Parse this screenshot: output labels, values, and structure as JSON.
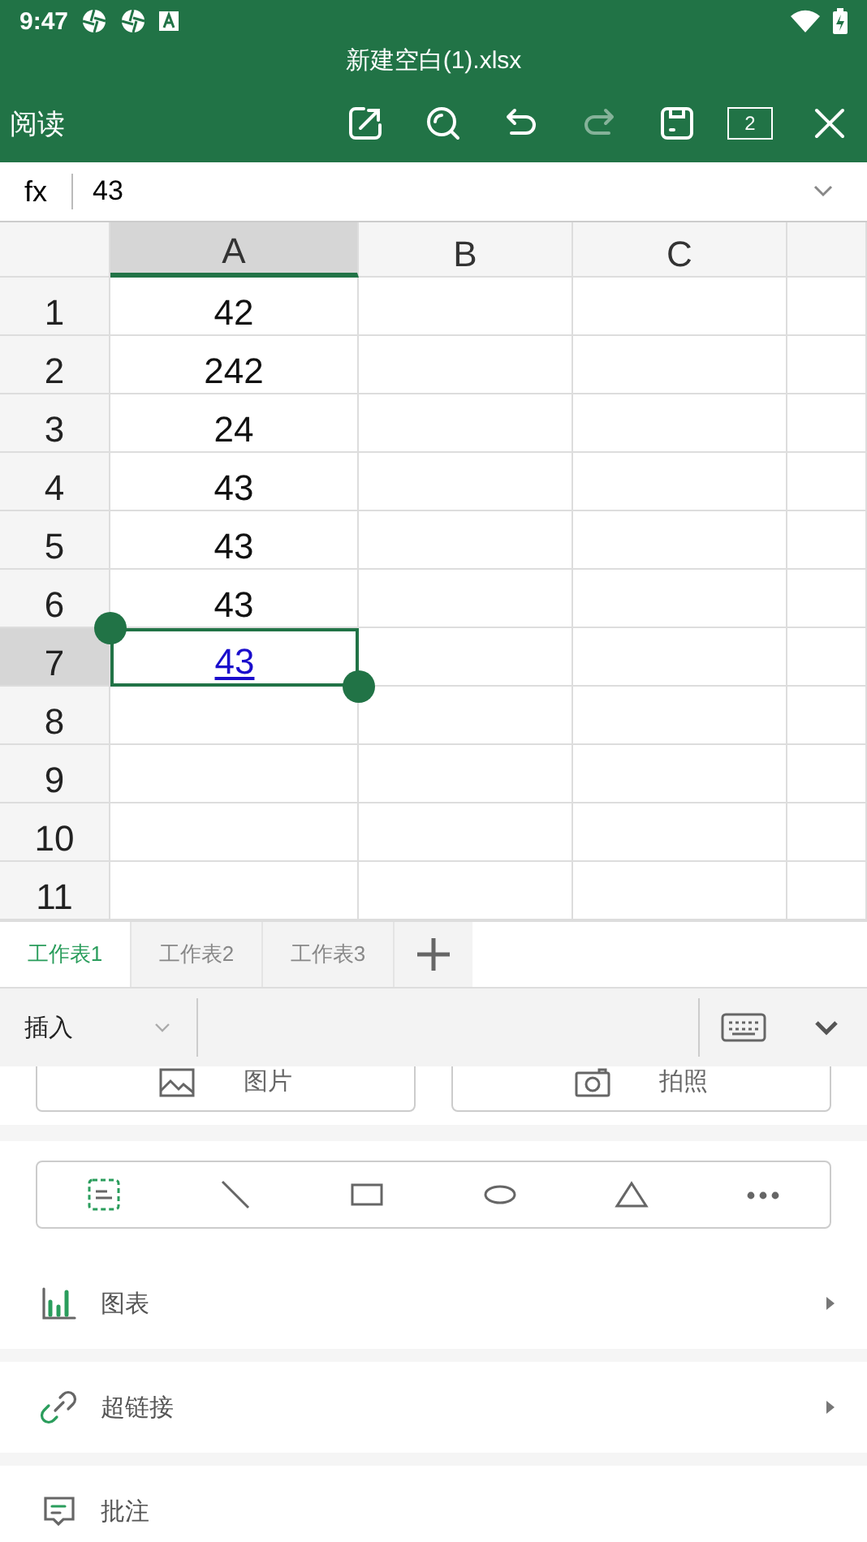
{
  "status_bar": {
    "time": "9:47"
  },
  "title": "新建空白(1).xlsx",
  "toolbar": {
    "mode": "阅读",
    "buttons": [
      {
        "kind": "share",
        "disabled": false
      },
      {
        "kind": "search",
        "disabled": false
      },
      {
        "kind": "undo",
        "disabled": false
      },
      {
        "kind": "redo",
        "disabled": true
      },
      {
        "kind": "save",
        "disabled": false
      },
      {
        "kind": "windows",
        "label": "2",
        "disabled": false
      },
      {
        "kind": "close",
        "disabled": false
      }
    ]
  },
  "formula_bar": {
    "label": "fx",
    "value": "43"
  },
  "sheet": {
    "columns": [
      {
        "label": "A",
        "selected": true
      },
      {
        "label": "B",
        "selected": false
      },
      {
        "label": "C",
        "selected": false
      }
    ],
    "rows": [
      {
        "label": "1",
        "selected": false,
        "cells": [
          {
            "text": "42",
            "link": false,
            "selected": false
          }
        ]
      },
      {
        "label": "2",
        "selected": false,
        "cells": [
          {
            "text": "242",
            "link": false,
            "selected": false
          }
        ]
      },
      {
        "label": "3",
        "selected": false,
        "cells": [
          {
            "text": "24",
            "link": false,
            "selected": false
          }
        ]
      },
      {
        "label": "4",
        "selected": false,
        "cells": [
          {
            "text": "43",
            "link": false,
            "selected": false
          }
        ]
      },
      {
        "label": "5",
        "selected": false,
        "cells": [
          {
            "text": "43",
            "link": false,
            "selected": false
          }
        ]
      },
      {
        "label": "6",
        "selected": false,
        "cells": [
          {
            "text": "43",
            "link": false,
            "selected": false
          }
        ]
      },
      {
        "label": "7",
        "selected": true,
        "cells": [
          {
            "text": "43",
            "link": true,
            "selected": true
          }
        ]
      },
      {
        "label": "8",
        "selected": false
      },
      {
        "label": "9",
        "selected": false
      },
      {
        "label": "10",
        "selected": false
      },
      {
        "label": "11",
        "selected": false
      }
    ]
  },
  "sheet_tabs": [
    {
      "label": "工作表1",
      "selected": true
    },
    {
      "label": "工作表2",
      "selected": false
    },
    {
      "label": "工作表3",
      "selected": false
    }
  ],
  "insert_panel": {
    "category": "插入",
    "buttons": [
      {
        "kind": "image",
        "label": "图片"
      },
      {
        "kind": "camera",
        "label": "拍照"
      }
    ],
    "shapes": [
      {
        "kind": "textbox",
        "selected": true
      },
      {
        "kind": "line",
        "selected": false
      },
      {
        "kind": "rectangle",
        "selected": false
      },
      {
        "kind": "ellipse",
        "selected": false
      },
      {
        "kind": "triangle",
        "selected": false
      },
      {
        "kind": "more",
        "selected": false
      }
    ],
    "items": [
      {
        "kind": "chart",
        "label": "图表",
        "submenu": true
      },
      {
        "kind": "link",
        "label": "超链接",
        "submenu": true
      },
      {
        "kind": "comment",
        "label": "批注",
        "submenu": false
      }
    ]
  }
}
